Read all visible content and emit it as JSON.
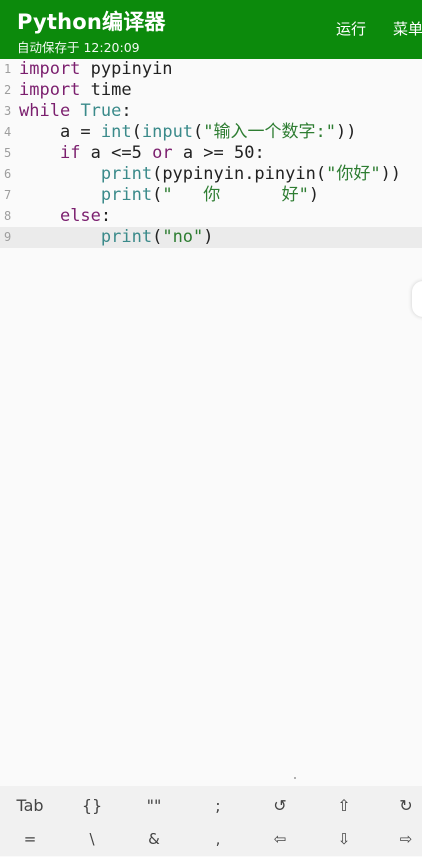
{
  "appbar": {
    "title": "Python编译器",
    "subtitle": "自动保存于 12:20:09",
    "run_label": "运行",
    "menu_label": "菜单"
  },
  "editor": {
    "current_line": 9,
    "lines": [
      {
        "num": "1",
        "tokens": [
          {
            "t": "import",
            "c": "kw"
          },
          {
            "t": " pypinyin",
            "c": "plain"
          }
        ]
      },
      {
        "num": "2",
        "tokens": [
          {
            "t": "import",
            "c": "kw"
          },
          {
            "t": " time",
            "c": "plain"
          }
        ]
      },
      {
        "num": "3",
        "tokens": [
          {
            "t": "while",
            "c": "kw"
          },
          {
            "t": " ",
            "c": "plain"
          },
          {
            "t": "True",
            "c": "bi"
          },
          {
            "t": ":",
            "c": "plain"
          }
        ]
      },
      {
        "num": "4",
        "tokens": [
          {
            "t": "    a = ",
            "c": "plain"
          },
          {
            "t": "int",
            "c": "bi"
          },
          {
            "t": "(",
            "c": "plain"
          },
          {
            "t": "input",
            "c": "bi"
          },
          {
            "t": "(",
            "c": "plain"
          },
          {
            "t": "\"输入一个数字:\"",
            "c": "str"
          },
          {
            "t": "))",
            "c": "plain"
          }
        ]
      },
      {
        "num": "5",
        "tokens": [
          {
            "t": "    ",
            "c": "plain"
          },
          {
            "t": "if",
            "c": "kw"
          },
          {
            "t": " a <=5 ",
            "c": "plain"
          },
          {
            "t": "or",
            "c": "kw"
          },
          {
            "t": " a >= 50:",
            "c": "plain"
          }
        ]
      },
      {
        "num": "6",
        "tokens": [
          {
            "t": "        ",
            "c": "plain"
          },
          {
            "t": "print",
            "c": "bi"
          },
          {
            "t": "(pypinyin.pinyin(",
            "c": "plain"
          },
          {
            "t": "\"你好\"",
            "c": "str"
          },
          {
            "t": "))",
            "c": "plain"
          }
        ]
      },
      {
        "num": "7",
        "tokens": [
          {
            "t": "        ",
            "c": "plain"
          },
          {
            "t": "print",
            "c": "bi"
          },
          {
            "t": "(",
            "c": "plain"
          },
          {
            "t": "\"   你      好\"",
            "c": "str"
          },
          {
            "t": ")",
            "c": "plain"
          }
        ]
      },
      {
        "num": "8",
        "tokens": [
          {
            "t": "    ",
            "c": "plain"
          },
          {
            "t": "else",
            "c": "kw"
          },
          {
            "t": ":",
            "c": "plain"
          }
        ]
      },
      {
        "num": "9",
        "tokens": [
          {
            "t": "        ",
            "c": "plain"
          },
          {
            "t": "print",
            "c": "bi"
          },
          {
            "t": "(",
            "c": "plain"
          },
          {
            "t": "\"no\"",
            "c": "str"
          },
          {
            "t": ")",
            "c": "plain"
          }
        ]
      }
    ]
  },
  "keyboard": {
    "row1": [
      "Tab",
      "{}",
      "\"\"",
      ";",
      "↺",
      "⇧",
      "↻"
    ],
    "row2": [
      "=",
      "\\",
      "&",
      ",",
      "⇦",
      "⇩",
      "⇨"
    ]
  }
}
